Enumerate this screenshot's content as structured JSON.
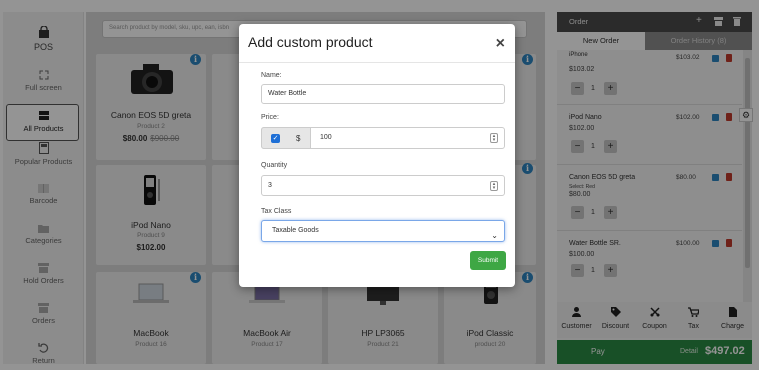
{
  "nav": {
    "items": [
      {
        "label": "POS"
      },
      {
        "label": "Full screen"
      },
      {
        "label": "All Products"
      },
      {
        "label": "Popular Products"
      },
      {
        "label": "Barcode"
      },
      {
        "label": "Categories"
      },
      {
        "label": "Hold Orders"
      },
      {
        "label": "Orders"
      },
      {
        "label": "Return"
      }
    ]
  },
  "search": {
    "placeholder": "Search product by model, sku, upc, ean, isbn"
  },
  "products": [
    {
      "name": "Canon EOS 5D greta",
      "sub": "Product 2",
      "price": "$80.00",
      "old_price": "$900.00"
    },
    {
      "name": "iPod Nano",
      "sub": "Product 9",
      "price": "$102.00",
      "old_price": ""
    },
    {
      "name": "MacBook",
      "sub": "Product 16",
      "price": "",
      "old_price": ""
    },
    {
      "name": "MacBook Air",
      "sub": "Product 17",
      "price": "",
      "old_price": ""
    },
    {
      "name": "HP LP3065",
      "sub": "Product 21",
      "price": "",
      "old_price": ""
    },
    {
      "name": "iPod Classic",
      "sub": "product 20",
      "price": "",
      "old_price": ""
    }
  ],
  "modal": {
    "title": "Add custom product",
    "close": "×",
    "name_label": "Name:",
    "name_value": "Water Bottle",
    "price_label": "Price:",
    "currency": "$",
    "price_value": "100",
    "quantity_label": "Quantity",
    "quantity_value": "3",
    "tax_label": "Tax Class",
    "tax_value": "Taxable Goods",
    "submit": "Submit"
  },
  "order": {
    "title": "Order",
    "tab_new": "New Order",
    "tab_history": "Order History (8)",
    "items": [
      {
        "name": "iPhone",
        "price": "$103.02",
        "total": "$103.02",
        "qty": "1",
        "sub": ""
      },
      {
        "name": "iPod Nano",
        "price": "$102.00",
        "total": "$102.00",
        "qty": "1",
        "sub": ""
      },
      {
        "name": "Canon EOS 5D greta",
        "price": "$80.00",
        "total": "$80.00",
        "qty": "1",
        "sub": "Select: Red"
      },
      {
        "name": "Water Bottle SR.",
        "price": "$100.00",
        "total": "$100.00",
        "qty": "1",
        "sub": ""
      }
    ],
    "actions": [
      "Customer",
      "Discount",
      "Coupon",
      "Tax",
      "Charge"
    ],
    "pay_label": "Pay",
    "detail_label": "Detail",
    "detail_total": "$497.02"
  },
  "colors": {
    "accent": "#2e86c1",
    "pay": "#2a8a44",
    "submit": "#3ea744",
    "header": "#4a4a4a"
  }
}
